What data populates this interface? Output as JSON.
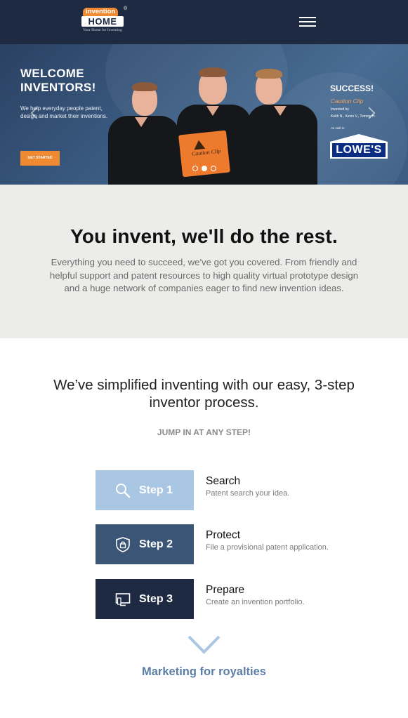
{
  "header": {
    "logo": {
      "top_text": "invention",
      "main_text": "HOME",
      "registered": "®",
      "tagline": "Your Home for Inventing"
    },
    "menu_icon": "hamburger-menu-icon",
    "colors": {
      "background": "#1d2a42",
      "accent": "#f08a32"
    }
  },
  "hero": {
    "title_line1": "WELCOME",
    "title_line2": "INVENTORS!",
    "subtitle": "We help everyday people patent, design and market their inventions.",
    "cta_label": "GET STARTED",
    "prev_icon": "chevron-left-icon",
    "next_icon": "chevron-right-icon",
    "product_sign_text": "Caution Clip",
    "success": {
      "title": "SUCCESS!",
      "product": "Caution Clip",
      "invented_by_label": "Invented by",
      "inventors": "Keith N., Kevin V., Tommy H.",
      "sold_in_label": "As sold in",
      "retailer": "LOWE'S"
    },
    "slides": {
      "count": 3,
      "active": 1
    }
  },
  "tagline": {
    "title": "You invent, we'll do the rest.",
    "text": "Everything you need to succeed, we've got you covered. From friendly and helpful support and patent resources to high quality virtual prototype design and a huge network of companies eager to find new invention ideas."
  },
  "process": {
    "title": "We’ve simplified inventing with our easy, 3-step inventor process.",
    "subtitle": "JUMP IN AT ANY STEP!",
    "steps": [
      {
        "label": "Step 1",
        "icon": "search-icon",
        "name": "Search",
        "desc": "Patent search your idea.",
        "color": "#a9c6e3"
      },
      {
        "label": "Step 2",
        "icon": "shield-lock-icon",
        "name": "Protect",
        "desc": "File a provisional patent application.",
        "color": "#3a5576"
      },
      {
        "label": "Step 3",
        "icon": "monitor-icon",
        "name": "Prepare",
        "desc": "Create an invention portfolio.",
        "color": "#1d2a42"
      }
    ],
    "chevron_icon": "chevron-down-icon",
    "marketing_label": "Marketing for royalties"
  }
}
